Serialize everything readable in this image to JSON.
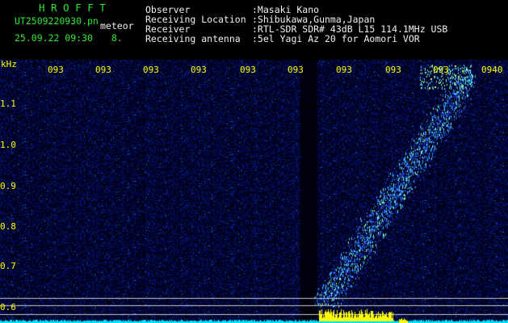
{
  "header": {
    "logo": "H R O F F T",
    "filename": "UT2509220930.pn",
    "tag": "meteor",
    "datetime": "25.09.22 09:30",
    "count": "8.",
    "fields": [
      {
        "label": "Observer",
        "value": ":Masaki Kano"
      },
      {
        "label": "Receiving Location",
        "value": ":Shibukawa,Gunma,Japan"
      },
      {
        "label": "Receiver",
        "value": ":RTL-SDR SDR# 43dB L15 114.1MHz USB"
      },
      {
        "label": "Receiving antenna",
        "value": ":5el Yagi Az 20 for Aomori VOR"
      }
    ]
  },
  "axis": {
    "unit": "kHz",
    "y_ticks": [
      "1.1",
      "1.0",
      "0.9",
      "0.8",
      "0.7",
      "0.6"
    ],
    "x_ticks": [
      "093",
      "093",
      "093",
      "093",
      "093",
      "093",
      "093",
      "093",
      "093",
      "0940"
    ]
  },
  "colors": {
    "background": "#000010",
    "text_green": "#2ee830",
    "axis_yellow": "#ffff00",
    "baseline_cyan": "#00e0ff"
  }
}
